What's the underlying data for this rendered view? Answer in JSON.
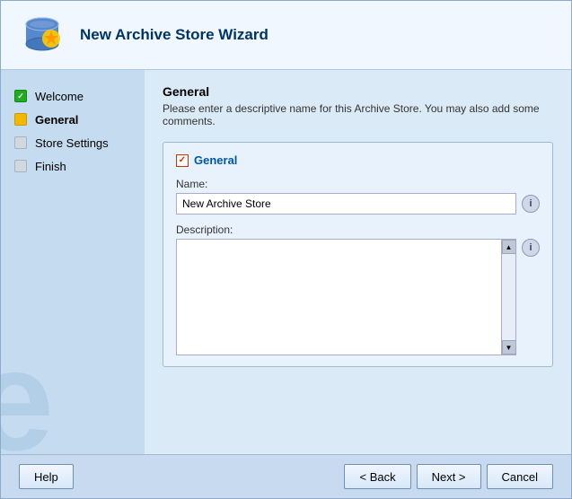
{
  "header": {
    "title": "New Archive Store Wizard",
    "icon_alt": "archive-store-wizard-icon"
  },
  "sidebar": {
    "watermark": "e",
    "items": [
      {
        "id": "welcome",
        "label": "Welcome",
        "status": "done"
      },
      {
        "id": "general",
        "label": "General",
        "status": "current"
      },
      {
        "id": "store-settings",
        "label": "Store Settings",
        "status": "pending"
      },
      {
        "id": "finish",
        "label": "Finish",
        "status": "pending"
      }
    ]
  },
  "main": {
    "section_title": "General",
    "section_desc": "Please enter a descriptive name for this Archive Store. You may also add some comments.",
    "form_group_label": "General",
    "name_label": "Name:",
    "name_value": "New Archive Store",
    "name_placeholder": "",
    "description_label": "Description:",
    "description_value": ""
  },
  "footer": {
    "help_label": "Help",
    "back_label": "< Back",
    "next_label": "Next >",
    "cancel_label": "Cancel"
  }
}
